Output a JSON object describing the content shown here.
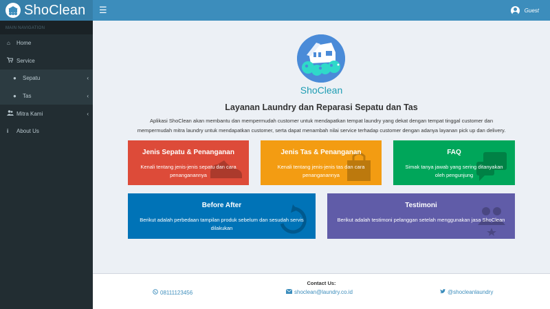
{
  "app": {
    "logo_text": "ShoClean",
    "menu_icon": "hamburger-icon"
  },
  "user": {
    "name": "Guest",
    "avatar_icon": "user-circle-icon"
  },
  "sidebar": {
    "header": "MAIN NAVIGATION",
    "items": [
      {
        "label": "Home",
        "icon": "home-icon"
      },
      {
        "label": "Service",
        "icon": "cart-icon"
      },
      {
        "label": "Sepatu",
        "icon": "circle-icon",
        "sub": true
      },
      {
        "label": "Tas",
        "icon": "circle-icon",
        "sub": true
      },
      {
        "label": "Mitra Kami",
        "icon": "users-icon"
      },
      {
        "label": "About Us",
        "icon": "info-icon"
      }
    ]
  },
  "main": {
    "brand_name": "ShoClean",
    "title": "Layanan Laundry dan Reparasi Sepatu dan Tas",
    "description_line1": "Aplikasi ShoClean akan membantu dan mempermudah customer untuk mendapatkan tempat laundry yang dekat dengan tempat tinggal customer dan",
    "description_line2": "mempermudah mitra laundry untuk mendapatkan customer, serta dapat menambah nilai service terhadap customer dengan adanya layanan pick up dan delivery.",
    "cards": [
      {
        "title": "Jenis Sepatu & Penanganan",
        "text": "Kenali tentang jenis-jenis sepatu dan cara penanganannya",
        "icon": "shoe-icon",
        "color": "#dd4b39"
      },
      {
        "title": "Jenis Tas & Penanganan",
        "text": "Kenali tentang jenis-jenis tas dan cara penanganannya",
        "icon": "bag-icon",
        "color": "#f39c12"
      },
      {
        "title": "FAQ",
        "text": "Simak tanya jawab yang sering ditanyakan oleh pengunjung",
        "icon": "question-chat-icon",
        "color": "#00a65a"
      },
      {
        "title": "Before After",
        "text": "Berikut adalah perbedaan tampilan produk sebelum dan sesudah servis dilakukan",
        "icon": "refresh-icon",
        "color": "#0073b7"
      },
      {
        "title": "Testimoni",
        "text": "Berikut adalah testimoni pelanggan setelah menggunakan jasa ShoClean",
        "icon": "rating-users-icon",
        "color": "#605ca8"
      }
    ]
  },
  "footer": {
    "contact_label": "Contact Us:",
    "phone": "08111123456",
    "email": "shoclean@laundry.co.id",
    "twitter": "@shocleanlaundry"
  }
}
